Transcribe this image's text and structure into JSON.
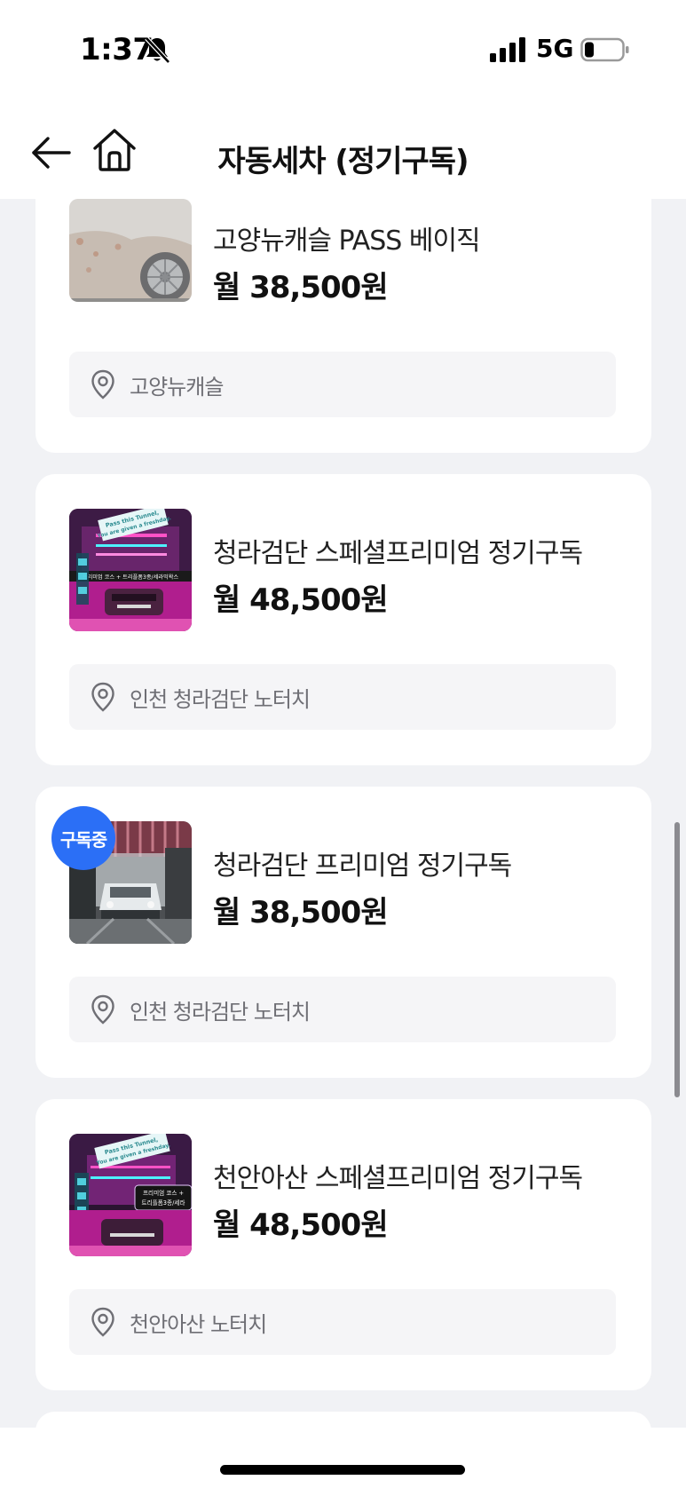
{
  "status": {
    "time": "1:37",
    "network": "5G"
  },
  "header": {
    "title": "자동세차 (정기구독)"
  },
  "items": [
    {
      "name": "고양뉴캐슬 PASS 베이직",
      "price": "월 38,500원",
      "location": "고양뉴캐슬",
      "badge": ""
    },
    {
      "name": "청라검단 스페셜프리미엄 정기구독",
      "price": "월 48,500원",
      "location": "인천 청라검단 노터치",
      "badge": "",
      "thumb_text": {
        "banner_line1": "Pass this Tunnel,",
        "banner_line2": "You are given a freshday.",
        "course": "프리미엄 코스 + 트리플폼3종/세라믹왁스"
      }
    },
    {
      "name": "청라검단 프리미엄 정기구독",
      "price": "월 38,500원",
      "location": "인천 청라검단 노터치",
      "badge": "구독중"
    },
    {
      "name": "천안아산 스페셜프리미엄 정기구독",
      "price": "월 48,500원",
      "location": "천안아산 노터치",
      "badge": "",
      "thumb_text": {
        "banner_line1": "Pass this Tunnel,",
        "banner_line2": "You are given a freshday.",
        "course_line1": "프리미엄 코스 +",
        "course_line2": "트리플폼3종/세라"
      }
    }
  ],
  "colors": {
    "badge": "#2b6ff6",
    "background": "#f1f2f5",
    "card": "#ffffff"
  }
}
